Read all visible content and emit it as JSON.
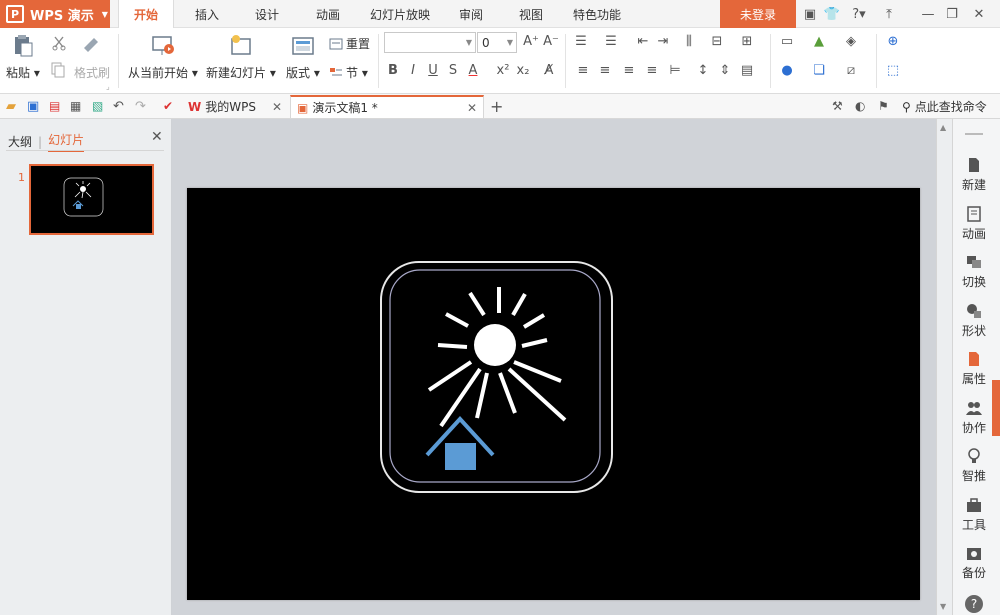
{
  "app": {
    "name": "WPS 演示",
    "logo_glyph": "P"
  },
  "menu_tabs": [
    "开始",
    "插入",
    "设计",
    "动画",
    "幻灯片放映",
    "审阅",
    "视图",
    "特色功能"
  ],
  "active_tab": "开始",
  "login_label": "未登录",
  "ribbon": {
    "paste": "粘贴",
    "format_painter": "格式刷",
    "from_current": "从当前开始",
    "new_slide": "新建幻灯片",
    "layout": "版式",
    "reset": "重置",
    "section": "节",
    "font_size": "0"
  },
  "doc_tabs": [
    {
      "label": "我的WPS",
      "active": false
    },
    {
      "label": "演示文稿1 *",
      "active": true
    }
  ],
  "search_label": "点此查找命令",
  "left_panel": {
    "tab_outline": "大纲",
    "tab_slides": "幻灯片",
    "slide_number": "1"
  },
  "right_panel": [
    "新建",
    "动画",
    "切换",
    "形状",
    "属性",
    "协作",
    "智推",
    "工具",
    "备份"
  ],
  "colors": {
    "accent": "#e4673a",
    "house": "#5b9bd5",
    "slide_bg": "#000000"
  }
}
